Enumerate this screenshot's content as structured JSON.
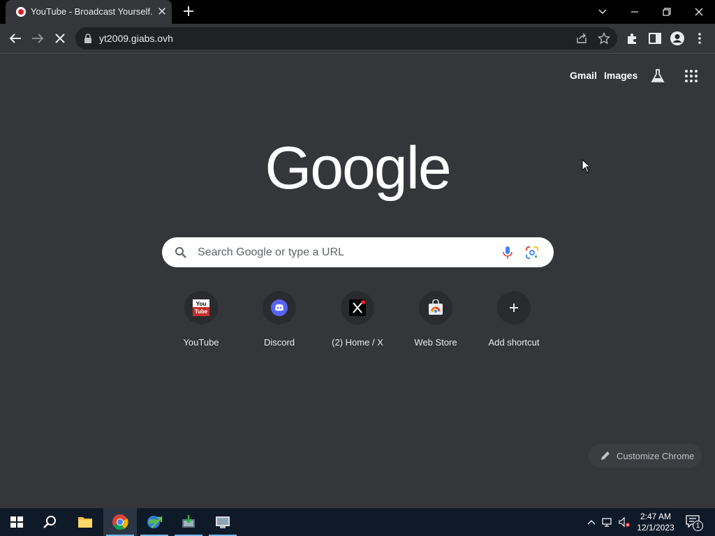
{
  "browser": {
    "tab_title": "YouTube - Broadcast Yourself.",
    "url": "yt2009.giabs.ovh"
  },
  "page": {
    "top_links": {
      "gmail": "Gmail",
      "images": "Images"
    },
    "logo_text": "Google",
    "search_placeholder": "Search Google or type a URL",
    "shortcuts": [
      {
        "label": "YouTube",
        "icon": "youtube-icon"
      },
      {
        "label": "Discord",
        "icon": "discord-icon"
      },
      {
        "label": "(2) Home / X",
        "icon": "x-icon"
      },
      {
        "label": "Web Store",
        "icon": "web-store-icon"
      },
      {
        "label": "Add shortcut",
        "icon": "plus-icon"
      }
    ],
    "customize_label": "Customize Chrome"
  },
  "taskbar": {
    "time": "2:47 AM",
    "date": "12/1/2023",
    "notification_count": "1"
  },
  "colors": {
    "page_bg": "#35363a",
    "title_bar": "#000000",
    "taskbar": "#0f1a29",
    "accent": "#76b9ed"
  }
}
